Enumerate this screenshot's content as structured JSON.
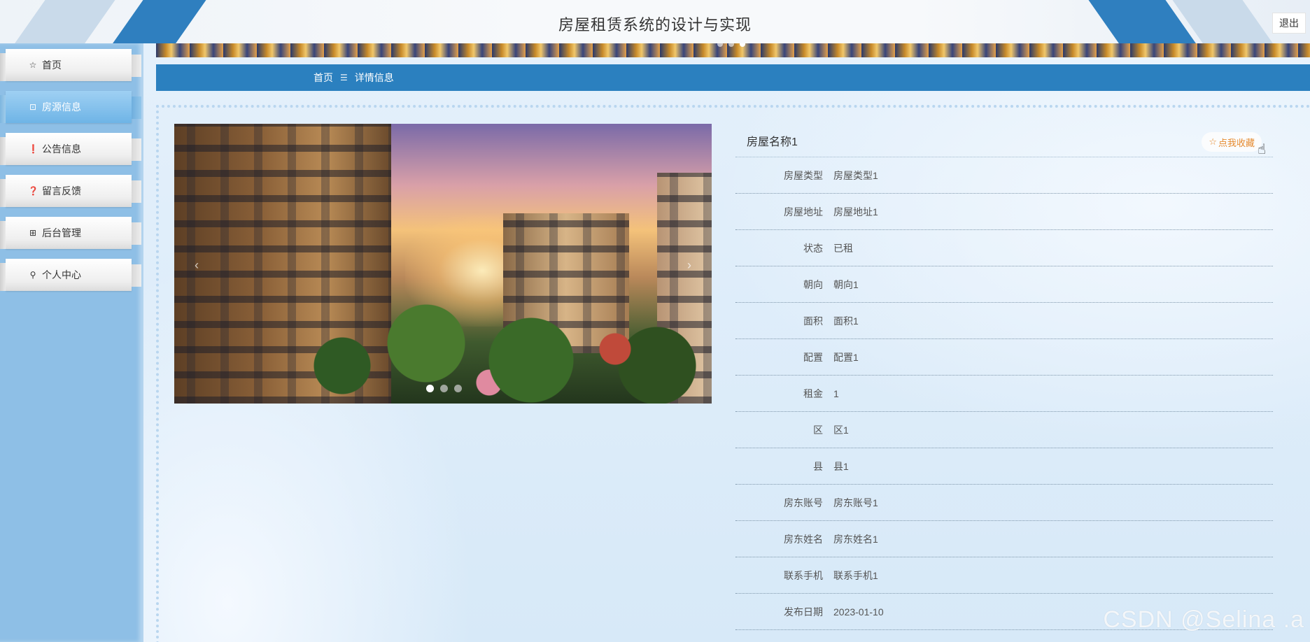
{
  "header": {
    "title": "房屋租赁系统的设计与实现",
    "logout_label": "退出"
  },
  "sidebar": {
    "items": [
      {
        "label": "首页",
        "icon": "star-outline-icon",
        "glyph": "☆"
      },
      {
        "label": "房源信息",
        "icon": "bag-icon",
        "glyph": "⊡",
        "active": true
      },
      {
        "label": "公告信息",
        "icon": "alert-circle-icon",
        "glyph": "❗"
      },
      {
        "label": "留言反馈",
        "icon": "help-circle-icon",
        "glyph": "❓"
      },
      {
        "label": "后台管理",
        "icon": "gift-icon",
        "glyph": "⊞"
      },
      {
        "label": "个人中心",
        "icon": "user-icon",
        "glyph": "⚲"
      }
    ]
  },
  "breadcrumb": {
    "home": "首页",
    "separator": "☰",
    "current": "详情信息"
  },
  "carousel": {
    "prev": "‹",
    "next": "›",
    "slide_count": 3,
    "active_index": 0
  },
  "detail": {
    "title": "房屋名称1",
    "favorite_label": "点我收藏",
    "favorite_icon": "☆",
    "fields": [
      {
        "label": "房屋类型",
        "value": "房屋类型1"
      },
      {
        "label": "房屋地址",
        "value": "房屋地址1"
      },
      {
        "label": "状态",
        "value": "已租"
      },
      {
        "label": "朝向",
        "value": "朝向1"
      },
      {
        "label": "面积",
        "value": "面积1"
      },
      {
        "label": "配置",
        "value": "配置1"
      },
      {
        "label": "租金",
        "value": "1"
      },
      {
        "label": "区",
        "value": "区1"
      },
      {
        "label": "县",
        "value": "县1"
      },
      {
        "label": "房东账号",
        "value": "房东账号1"
      },
      {
        "label": "房东姓名",
        "value": "房东姓名1"
      },
      {
        "label": "联系手机",
        "value": "联系手机1"
      },
      {
        "label": "发布日期",
        "value": "2023-01-10"
      }
    ]
  },
  "watermark": "CSDN @Selina .a",
  "colors": {
    "accent": "#2b80bf",
    "sidebar": "#8ebfe6",
    "favorite": "#e68a2e"
  }
}
